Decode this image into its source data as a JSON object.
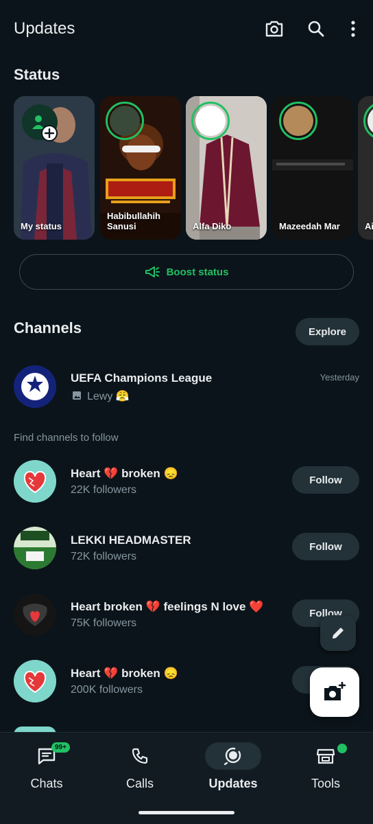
{
  "header": {
    "title": "Updates",
    "icons": [
      "camera-icon",
      "search-icon",
      "more-vert-icon"
    ]
  },
  "status": {
    "section_title": "Status",
    "items": [
      {
        "name": "My status"
      },
      {
        "name": "Habibullahih Sanusi"
      },
      {
        "name": "Alfa Diko"
      },
      {
        "name": "Mazeedah Mar"
      },
      {
        "name": "Ai"
      }
    ],
    "boost_label": "Boost status"
  },
  "channels": {
    "section_title": "Channels",
    "explore_label": "Explore",
    "followed": [
      {
        "name": "UEFA Champions League",
        "last_message": "Lewy 😤",
        "time": "Yesterday"
      }
    ],
    "find_label": "Find channels to follow",
    "suggestions": [
      {
        "name": "Heart 💔 broken 😞",
        "followers": "22K followers",
        "follow_label": "Follow"
      },
      {
        "name": "LEKKI HEADMASTER",
        "followers": "72K followers",
        "follow_label": "Follow"
      },
      {
        "name": "Heart broken 💔 feelings N love ❤️",
        "followers": "75K followers",
        "follow_label": "Follow"
      },
      {
        "name": "Heart 💔 broken 😞",
        "followers": "200K followers",
        "follow_label": "Follow"
      }
    ]
  },
  "bottom_nav": {
    "items": [
      {
        "label": "Chats",
        "badge": "99+"
      },
      {
        "label": "Calls"
      },
      {
        "label": "Updates",
        "active": true
      },
      {
        "label": "Tools"
      }
    ]
  },
  "colors": {
    "background": "#0b141a",
    "accent": "#21c063",
    "button_bg": "#233138",
    "secondary_text": "#8696a0"
  }
}
